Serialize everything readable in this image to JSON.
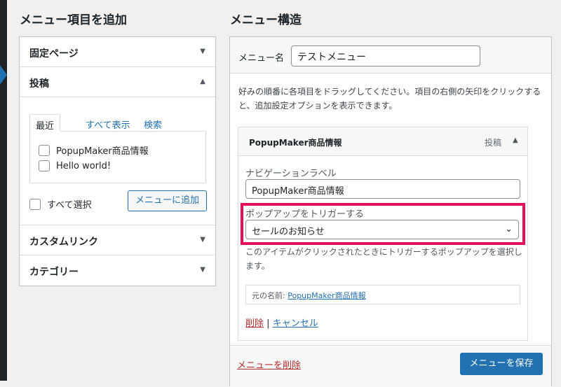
{
  "left": {
    "title": "メニュー項目を追加",
    "sections": {
      "fixed_page": "固定ページ",
      "posts": "投稿",
      "custom_link": "カスタムリンク",
      "category": "カテゴリー"
    },
    "arrows": {
      "down": "▼",
      "up": "▲"
    },
    "tabs": [
      "最近",
      "すべて表示",
      "検索"
    ],
    "posts_list": [
      {
        "label": "PopupMaker商品情報",
        "checked": false
      },
      {
        "label": "Hello world!",
        "checked": false
      }
    ],
    "select_all_label": "すべて選択",
    "add_button": "メニューに追加"
  },
  "right": {
    "title": "メニュー構造",
    "menu_name_label": "メニュー名",
    "menu_name_value": "テストメニュー",
    "instructions": "好みの順番に各項目をドラッグしてください。項目の右側の矢印をクリックすると、追加設定オプションを表示できます。",
    "item": {
      "title": "PopupMaker商品情報",
      "type": "投稿",
      "arrow": "▲",
      "nav_label_label": "ナビゲーションラベル",
      "nav_label_value": "PopupMaker商品情報",
      "trigger_label": "ポップアップをトリガーする",
      "trigger_value": "セールのお知らせ",
      "trigger_desc": "このアイテムがクリックされたときにトリガーするポップアップを選択します。",
      "original_label": "元の名前:",
      "original_link": "PopupMaker商品情報",
      "remove": "削除",
      "separator": "|",
      "cancel": "キャンセル"
    },
    "delete_menu": "メニューを削除",
    "save_button": "メニューを保存"
  },
  "colors": {
    "accent": "#2271b1",
    "danger": "#b32d2e",
    "highlight": "#e60d5b"
  }
}
